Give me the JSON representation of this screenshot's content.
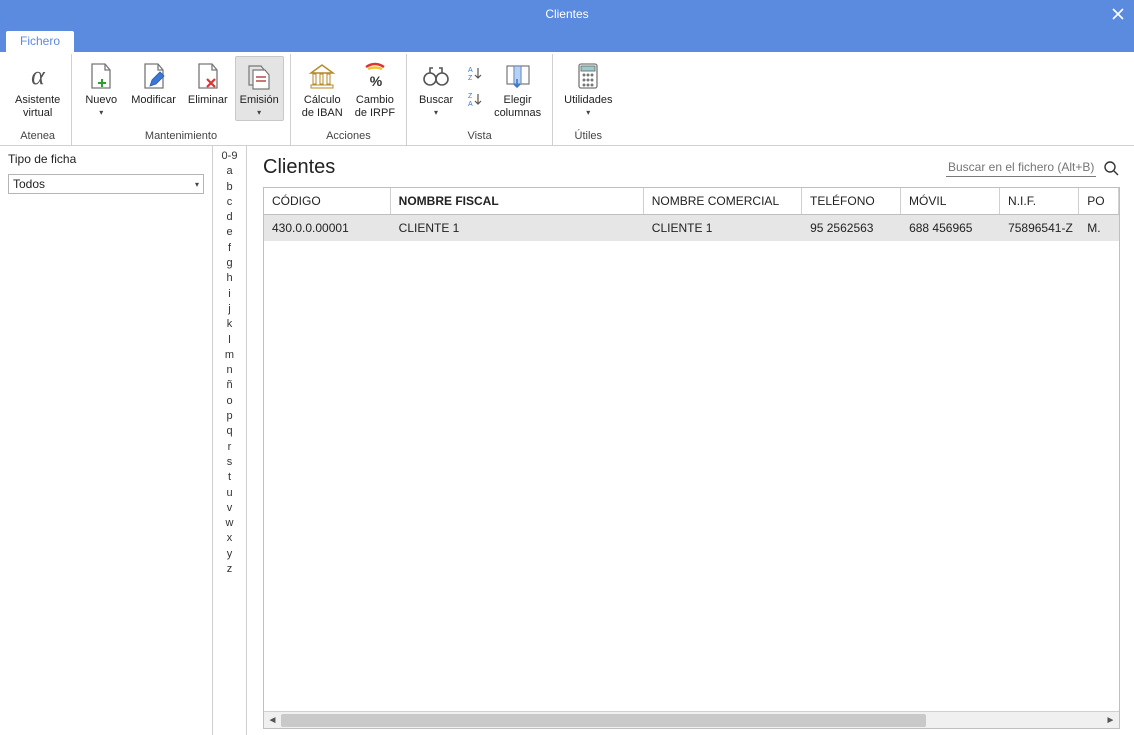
{
  "window": {
    "title": "Clientes"
  },
  "tabs": {
    "fichero": "Fichero"
  },
  "ribbon": {
    "atenea": {
      "label": "Atenea",
      "asistente": "Asistente\nvirtual"
    },
    "mantenimiento": {
      "label": "Mantenimiento",
      "nuevo": "Nuevo",
      "modificar": "Modificar",
      "eliminar": "Eliminar",
      "emision": "Emisión"
    },
    "acciones": {
      "label": "Acciones",
      "iban": "Cálculo\nde IBAN",
      "irpf": "Cambio\nde IRPF"
    },
    "vista": {
      "label": "Vista",
      "buscar": "Buscar",
      "elegir": "Elegir\ncolumnas"
    },
    "utiles": {
      "label": "Útiles",
      "utilidades": "Utilidades"
    }
  },
  "left": {
    "tipo_label": "Tipo de ficha",
    "tipo_value": "Todos"
  },
  "alpha": [
    "0-9",
    "a",
    "b",
    "c",
    "d",
    "e",
    "f",
    "g",
    "h",
    "i",
    "j",
    "k",
    "l",
    "m",
    "n",
    "ñ",
    "o",
    "p",
    "q",
    "r",
    "s",
    "t",
    "u",
    "v",
    "w",
    "x",
    "y",
    "z"
  ],
  "main": {
    "title": "Clientes",
    "search_placeholder": "Buscar en el fichero (Alt+B)"
  },
  "grid": {
    "headers": [
      "CÓDIGO",
      "NOMBRE FISCAL",
      "NOMBRE COMERCIAL",
      "TELÉFONO",
      "MÓVIL",
      "N.I.F.",
      "PO"
    ],
    "rows": [
      {
        "codigo": "430.0.0.00001",
        "nombre_fiscal": "CLIENTE 1",
        "nombre_comercial": "CLIENTE 1",
        "telefono": "95 2562563",
        "movil": "688 456965",
        "nif": "75896541-Z",
        "po": "M."
      }
    ]
  }
}
